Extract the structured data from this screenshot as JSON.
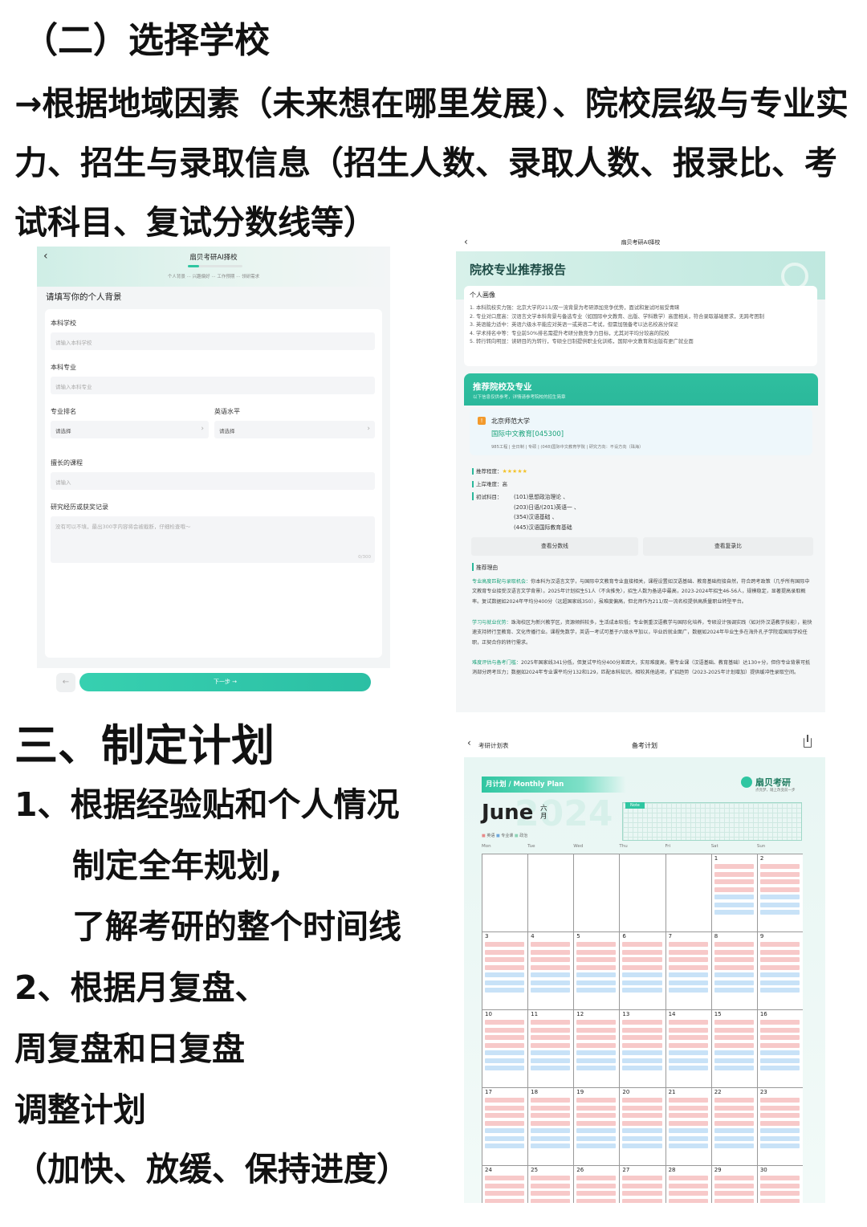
{
  "heading1": "（二）选择学校",
  "para1": "→根据地域因素（未来想在哪里发展）、院校层级与专业实力、招生与录取信息（招生人数、录取人数、报录比、考试科目、复试分数线等）",
  "heading2": "三、制定计划",
  "steps": [
    "1、根据经验贴和个人情况",
    "制定全年规划,",
    "了解考研的整个时间线",
    "2、根据月复盘、",
    "周复盘和日复盘",
    "调整计划",
    "（加快、放缓、保持进度）"
  ],
  "form": {
    "back_icon": "chevron-left-icon",
    "title": "扇贝考研AI择校",
    "progress_steps": "个人背景 ··· 兴趣偏好 ··· 工作预期 ··· 领研需求",
    "progress": 0.1,
    "section_title": "请填写你的个人背景",
    "school_label": "本科学校",
    "school_placeholder": "请输入本科学校",
    "major_label": "本科专业",
    "major_placeholder": "请输入本科专业",
    "rank_label": "专业排名",
    "rank_value": "请选择",
    "english_label": "英语水平",
    "english_value": "请选择",
    "course_label": "擅长的课程",
    "course_placeholder": "请输入",
    "research_label": "研究经历或获奖记录",
    "research_placeholder": "没有可以不填，最出300字内容将会被截断，仔细检查哦～",
    "counter": "0/300",
    "prev_icon": "arrow-left-icon",
    "next_label": "下一步 →"
  },
  "report": {
    "back_icon": "chevron-left-icon",
    "nav_title": "扇贝考研AI择校",
    "title": "院校专业推荐报告",
    "profile_title": "个人画像",
    "profile_lines": [
      "1. 本科院校实力强：北京大学的211/双一流背景为考研添加竞争优势，面试和复试时易受青睐",
      "2. 专业对口度高：汉语言文学本科背景与备选专业（如国际中文教育、出版、学科教学）高度相关，符合录取基础要求，无跨考困制",
      "3. 英语能力适中：英语六级水平能应对英语一或英语二考试，但需加强备考以达名校高分保证",
      "4. 学术排名中等：专业前50%排名需提升考研分数竞争力目标，尤其对平均分较高的院校",
      "5. 转行转向明显：读研目的为转行，专硕全日制提供职业化训练，国际中文教育和出版有更广就业面"
    ],
    "rec_title": "推荐院校及专业",
    "rec_sub": "以下信息仅供参考，详情请参考院校的招生简章",
    "school": "北京师范大学",
    "major": "国际中文教育[045300]",
    "tags": "985工程 | 全日制 | 专硕 | (048)国际中文教育学院 | 研究方向：不设方向（珠海）",
    "rec_level_label": "推荐程度：",
    "stars": "★★★★★",
    "difficulty_label": "上岸难度：",
    "difficulty": "高",
    "subjects_label": "初试科目：",
    "subjects": [
      "(101)思想政治理论 、",
      "(203)日语/(201)英语一 、",
      "(354)汉语基础 、",
      "(445)汉语国际教育基础"
    ],
    "btn_score": "查看分数线",
    "btn_ratio": "查看复录比",
    "reason_title": "推荐理由",
    "reason1_key": "专业高度匹配与录取机会：",
    "reason1": "你本科为汉语言文学，与国际中文教育专业直接相关，课程设置如汉语基础、教育基础衔接自然，符合跨考政策（几乎所有国际中文教育专业接受汉语言文学背景）。2025年计划招生51人（不含推免），招生人数为备选中最高，2023-2024年招生46-56人，规模稳定，显著提高录取概率。复试数据如2024年平均分400分（远超国家线350），虽难度偏高，但北师作为211/双一流名校提供高质量职业转型平台。",
    "reason2_key": "学习与就业优势：",
    "reason2": "珠海校区为新兴教学区，资源倾斜较多，生活成本较低；专业侧重汉语教学与国际化培养，专硕设计强调实践（如对外汉语教学技能），能快速支持转行至教育、文化传播行业。课程免数学，英语一考试可基于六级水平加以，毕业后就业面广，数据如2024年毕业生多在海外孔子学院或国际学校任职，正契合你的转行需求。",
    "reason3_key": "难度评估与备考门槛：",
    "reason3": "2025年国家线341分低，但复试平均分400分差距大，实际难度高，需专业课（汉语基础、教育基础）达130+分，但你专业背景可抵消部分跨考压力；数据如2024年专业课平均分132和129，匹配本科知识。相较其他选项，扩招趋势（2023-2025年计划增加）提供缓冲性录取空间。"
  },
  "calendar": {
    "back_icon": "chevron-left-icon",
    "back_label": "考研计划表",
    "nav_title": "备考计划",
    "share_icon": "share-icon",
    "banner": "月计划 / Monthly Plan",
    "brand": "扇贝考研",
    "brand_sub": "点亮梦，踏上改变前一步",
    "month": "June",
    "month_cn": "六月",
    "year": "2024",
    "note_label": "Note",
    "legend": [
      "英语",
      "专业课",
      "政治"
    ],
    "weekdays": [
      "Mon",
      "Tue",
      "Wed",
      "Thu",
      "Fri",
      "Sat",
      "Sun"
    ],
    "days": [
      "",
      "",
      "",
      "",
      "",
      "1",
      "2",
      "3",
      "4",
      "5",
      "6",
      "7",
      "8",
      "9",
      "10",
      "11",
      "12",
      "13",
      "14",
      "15",
      "16",
      "17",
      "18",
      "19",
      "20",
      "21",
      "22",
      "23",
      "24",
      "25",
      "26",
      "27",
      "28",
      "29",
      "30"
    ],
    "colors": {
      "task_red": "#f7c9c9",
      "task_blue": "#c8e2f7",
      "accent": "#2fc6a1"
    }
  }
}
